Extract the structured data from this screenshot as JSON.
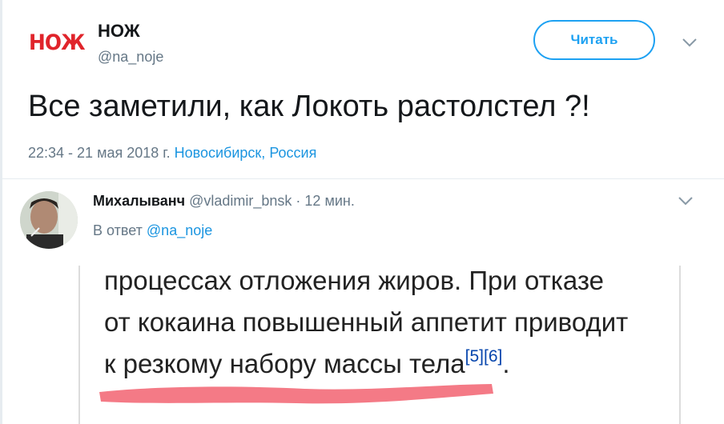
{
  "author": {
    "logo_text": "НОЖ",
    "name": "НОЖ",
    "handle": "@na_noje"
  },
  "follow_button": {
    "label": "Читать"
  },
  "tweet": {
    "text": "Все заметили, как Локоть растолстел ?!",
    "time": "22:34 - 21 мая 2018 г.",
    "location": "Новосибирск, Россия"
  },
  "reply": {
    "name": "Михалыванч",
    "handle": "@vladimir_bnsk",
    "separator": "·",
    "time": "12 мин.",
    "reply_to_prefix": "В ответ",
    "reply_to_mention": "@na_noje",
    "media": {
      "line1": "процессах отложения жиров. При отказе",
      "line2": "от кокаина повышенный аппетит приводит",
      "line3": "к резкому набору массы тела",
      "cite5": "[5]",
      "cite6": "[6]",
      "line3_end": ".",
      "underline_color": "#f47a86"
    }
  },
  "colors": {
    "accent": "#1da1f2",
    "link": "#1b95e0",
    "muted": "#657786",
    "logo": "#e0242b"
  },
  "icons": {
    "chevron": "chevron-down-icon"
  }
}
